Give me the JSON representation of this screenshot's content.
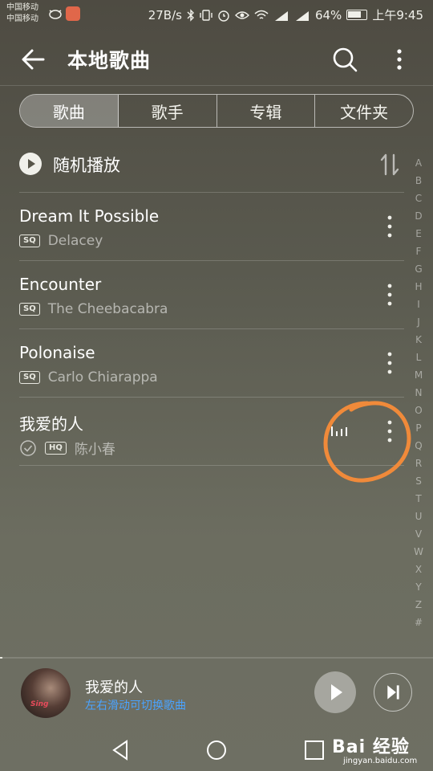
{
  "status_bar": {
    "carrier_1": "中国移动",
    "carrier_2": "中国移动",
    "speed": "27B/s",
    "battery": "64%",
    "time": "上午9:45"
  },
  "header": {
    "title": "本地歌曲"
  },
  "tabs": [
    {
      "label": "歌曲",
      "active": true
    },
    {
      "label": "歌手",
      "active": false
    },
    {
      "label": "专辑",
      "active": false
    },
    {
      "label": "文件夹",
      "active": false
    }
  ],
  "shuffle": {
    "label": "随机播放"
  },
  "songs": [
    {
      "title": "Dream It Possible",
      "quality": "SQ",
      "artist": "Delacey"
    },
    {
      "title": "Encounter",
      "quality": "SQ",
      "artist": "The Cheebacabra"
    },
    {
      "title": "Polonaise",
      "quality": "SQ",
      "artist": "Carlo Chiarappa"
    },
    {
      "title": "我爱的人",
      "quality": "HQ",
      "artist": "陈小春",
      "downloaded": true,
      "playing": true
    }
  ],
  "index_letters": [
    "A",
    "B",
    "C",
    "D",
    "E",
    "F",
    "G",
    "H",
    "I",
    "J",
    "K",
    "L",
    "M",
    "N",
    "O",
    "P",
    "Q",
    "R",
    "S",
    "T",
    "U",
    "V",
    "W",
    "X",
    "Y",
    "Z",
    "#"
  ],
  "player": {
    "title": "我爱的人",
    "hint": "左右滑动可切换歌曲",
    "album_text": "Sing"
  },
  "watermark": {
    "main": "Bai 经验",
    "sub": "jingyan.baidu.com"
  },
  "colors": {
    "accent_hint": "#4aa3ff",
    "annotation": "#f08a3a"
  }
}
